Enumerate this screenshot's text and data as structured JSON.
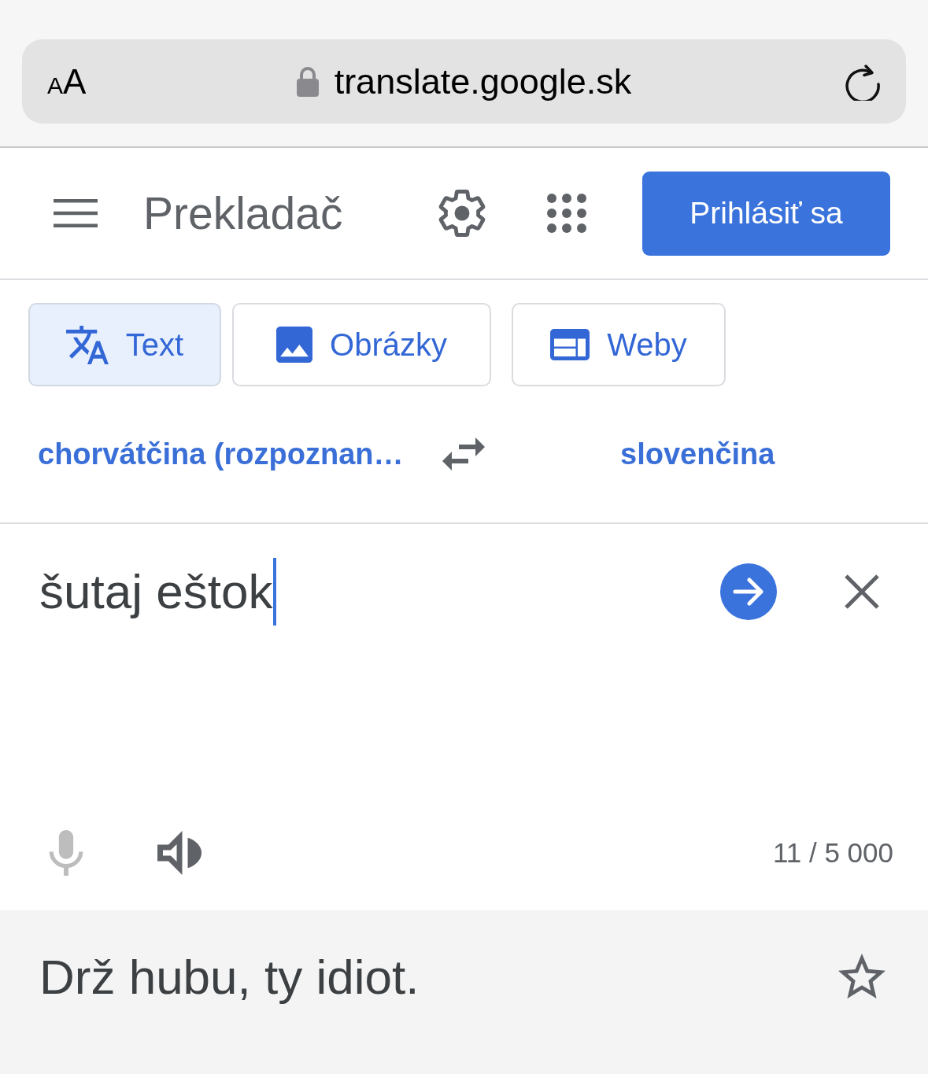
{
  "browser": {
    "text_size_button": "AA",
    "url": "translate.google.sk",
    "secure": true
  },
  "header": {
    "title": "Prekladač",
    "sign_in": "Prihlásiť sa"
  },
  "modes": [
    {
      "label": "Text",
      "kind": "text",
      "selected": true
    },
    {
      "label": "Obrázky",
      "kind": "images",
      "selected": false
    },
    {
      "label": "Weby",
      "kind": "websites",
      "selected": false
    }
  ],
  "languages": {
    "source": "chorvátčina (rozpoznan…",
    "target": "slovenčina"
  },
  "input": {
    "value": "šutaj eštok",
    "focused": true,
    "counter": "11 / 5 000",
    "mic_disabled": true
  },
  "output": {
    "text": "Drž hubu, ty idiot.",
    "saved": false
  }
}
